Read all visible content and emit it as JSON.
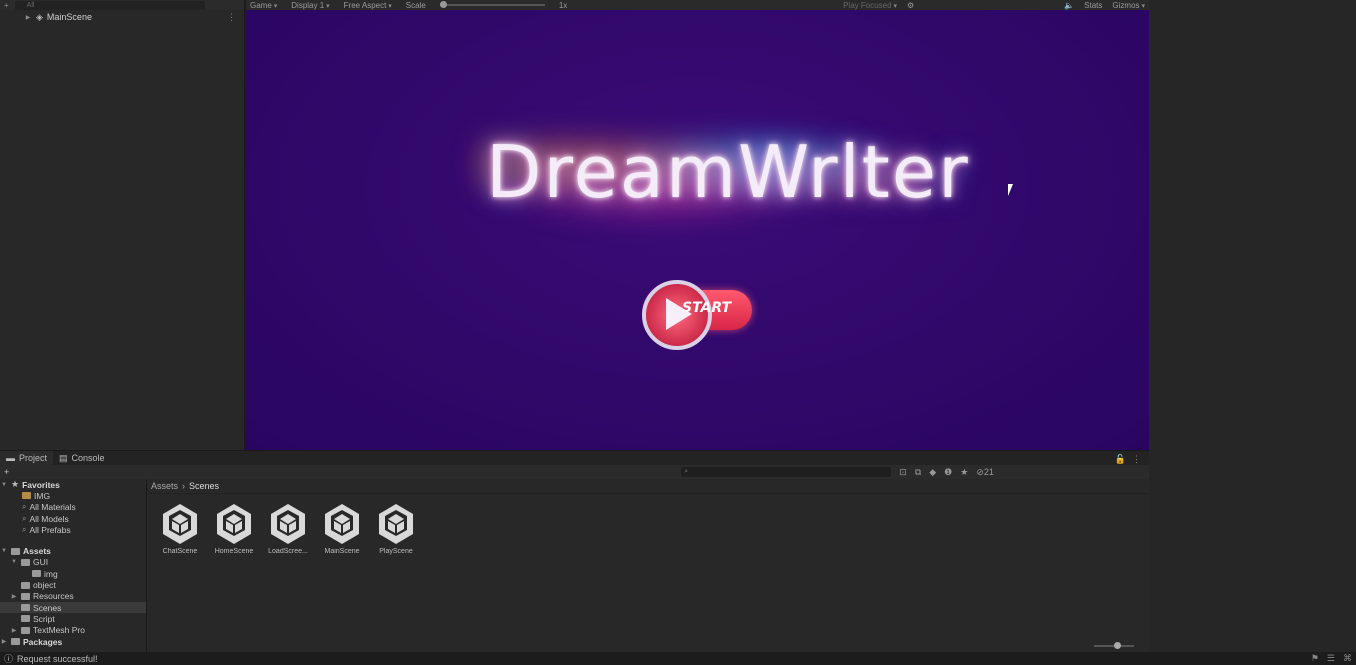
{
  "hierarchy": {
    "add_label": "+",
    "search_placeholder": "All",
    "scene_name": "MainScene"
  },
  "game_toolbar": {
    "view_label": "Game",
    "display_label": "Display 1",
    "aspect_label": "Free Aspect",
    "scale_label": "Scale",
    "scale_value": "1x",
    "scale_fraction": 0,
    "play_mode": "Play Focused",
    "stats_label": "Stats",
    "gizmos_label": "Gizmos"
  },
  "game": {
    "title": "DreamWrlter",
    "start_label": "START",
    "background_color": "#30086a"
  },
  "project": {
    "tabs": [
      {
        "label": "Project",
        "icon": "folder-icon"
      },
      {
        "label": "Console",
        "icon": "console-icon"
      }
    ],
    "add_label": "+",
    "hidden_count": "21",
    "favorites": {
      "label": "Favorites",
      "items": [
        "IMG",
        "All Materials",
        "All Models",
        "All Prefabs"
      ]
    },
    "assets": {
      "label": "Assets",
      "items": [
        {
          "label": "GUI",
          "depth": 1
        },
        {
          "label": "img",
          "depth": 2
        },
        {
          "label": "object",
          "depth": 1
        },
        {
          "label": "Resources",
          "depth": 1
        },
        {
          "label": "Scenes",
          "depth": 1,
          "selected": true
        },
        {
          "label": "Script",
          "depth": 1
        },
        {
          "label": "TextMesh Pro",
          "depth": 1
        }
      ]
    },
    "packages_label": "Packages",
    "breadcrumb": [
      "Assets",
      "Scenes"
    ],
    "scenes": [
      "ChatScene",
      "HomeScene",
      "LoadScree...",
      "MainScene",
      "PlayScene"
    ]
  },
  "status": {
    "message": "Request successful!"
  }
}
